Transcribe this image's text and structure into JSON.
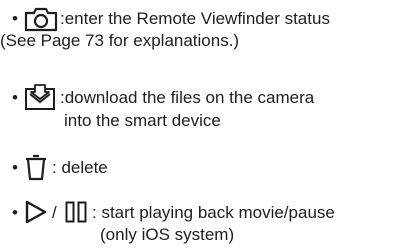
{
  "items": [
    {
      "icon": "camera-icon",
      "lines": [
        ":enter the Remote Viewfinder status",
        "(See Page 73 for explanations.)"
      ]
    },
    {
      "icon": "download-icon",
      "lines": [
        ":download the files on the camera",
        "into the smart device"
      ]
    },
    {
      "icon": "trash-icon",
      "lines": [
        ": delete"
      ]
    },
    {
      "icon": "play-pause-icon",
      "separator": "/",
      "lines": [
        ": start playing back movie/pause",
        "(only iOS system)"
      ]
    }
  ]
}
